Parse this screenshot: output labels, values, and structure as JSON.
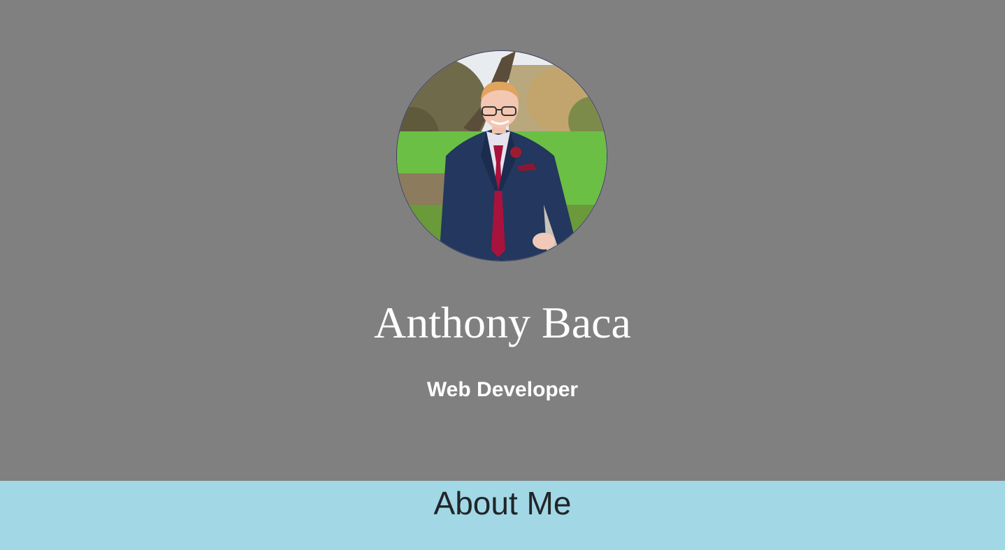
{
  "hero": {
    "name": "Anthony Baca",
    "role": "Web Developer",
    "bg_color": "#808080",
    "avatar_alt": "profile photo"
  },
  "about": {
    "heading": "About Me",
    "bg_color": "#a2d8e6"
  }
}
